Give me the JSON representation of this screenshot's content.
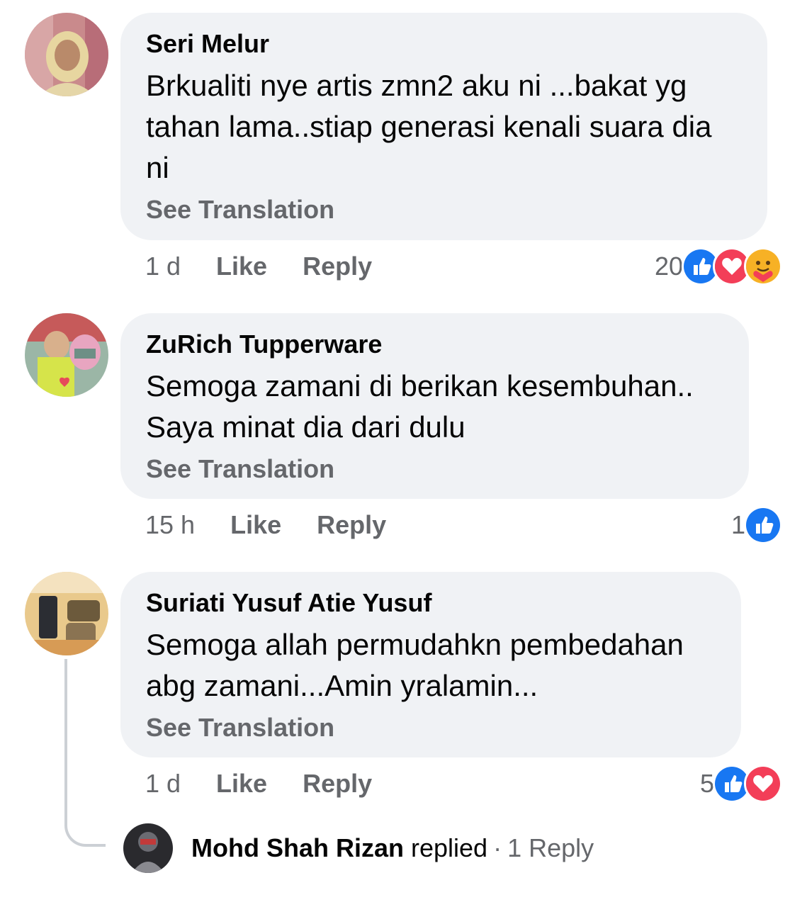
{
  "comments": [
    {
      "author": "Seri Melur",
      "text": "Brkualiti nye artis zmn2 aku ni ...bakat yg tahan lama..stiap generasi kenali suara dia ni",
      "see_translation": "See Translation",
      "time": "1 d",
      "like_label": "Like",
      "reply_label": "Reply",
      "reaction_count": "20",
      "reactions": [
        "like-icon",
        "love-icon",
        "care-icon"
      ]
    },
    {
      "author": "ZuRich Tupperware",
      "text": "Semoga zamani di berikan kesembuhan.. Saya minat dia dari dulu",
      "see_translation": "See Translation",
      "time": "15 h",
      "like_label": "Like",
      "reply_label": "Reply",
      "reaction_count": "1",
      "reactions": [
        "like-icon"
      ]
    },
    {
      "author": "Suriati Yusuf Atie Yusuf",
      "text": "Semoga allah permudahkn pembedahan abg zamani...Amin yralamin...",
      "see_translation": "See Translation",
      "time": "1 d",
      "like_label": "Like",
      "reply_label": "Reply",
      "reaction_count": "5",
      "reactions": [
        "like-icon",
        "love-icon"
      ],
      "reply_preview": {
        "name": "Mohd Shah Rizan",
        "verb": "replied",
        "separator": "·",
        "count": "1 Reply"
      }
    }
  ],
  "colors": {
    "bubble": "#f0f2f5",
    "secondary_text": "#65676b",
    "like_blue": "#1877f2",
    "love_red": "#f33e58",
    "care_yellow": "#f7b125"
  }
}
